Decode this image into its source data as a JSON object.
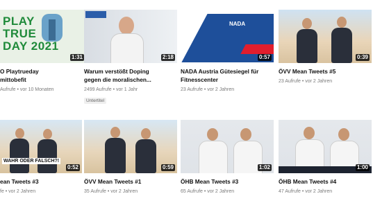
{
  "videos": [
    {
      "title1": "O Playtrueday",
      "title2": "mittobefit",
      "meta": "Aufrufe • vor 10 Monaten",
      "duration": "1:31"
    },
    {
      "title1": "Warum verstößt Doping",
      "title2": "gegen die moralischen...",
      "meta": "2499 Aufrufe • vor 1 Jahr",
      "duration": "2:18",
      "badge": "Untertitel"
    },
    {
      "title1": "NADA Austria Gütesiegel für",
      "title2": "Fitnesscenter",
      "meta": "23 Aufrufe • vor 2 Jahren",
      "duration": "0:57"
    },
    {
      "title1": "ÖVV Mean Tweets #5",
      "title2": "",
      "meta": "23 Aufrufe • vor 2 Jahren",
      "duration": "0:39"
    },
    {
      "title1": "ean Tweets #3",
      "title2": "",
      "meta": "fe • vor 2 Jahren",
      "duration": "0:52",
      "overlay": "WAHR ODER FALSCH?!"
    },
    {
      "title1": "ÖVV Mean Tweets #1",
      "title2": "",
      "meta": "35 Aufrufe • vor 2 Jahren",
      "duration": "0:59"
    },
    {
      "title1": "ÖHB Mean Tweets #3",
      "title2": "",
      "meta": "65 Aufrufe • vor 2 Jahren",
      "duration": "1:02"
    },
    {
      "title1": "ÖHB Mean Tweets #4",
      "title2": "",
      "meta": "47 Aufrufe • vor 2 Jahren",
      "duration": "1:00"
    }
  ],
  "thumb_text": {
    "playtrue": "PLAY\nTRUE\nDAY 2021",
    "nada": "NADA"
  },
  "colors": {
    "duration_bg": "#000000",
    "meta": "#7a7a7a"
  }
}
